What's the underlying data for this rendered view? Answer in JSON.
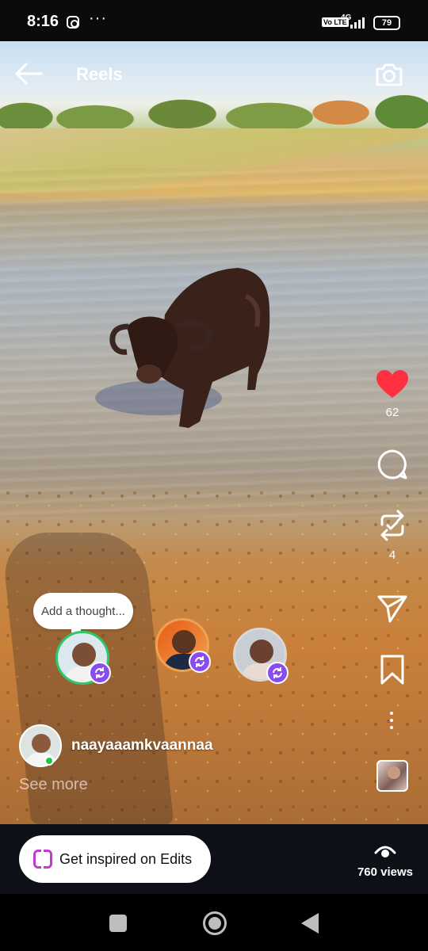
{
  "status_bar": {
    "time": "8:16",
    "dots": "···",
    "volte": "Vo LTE",
    "network": "4G",
    "battery": "79"
  },
  "header": {
    "title": "Reels",
    "back_icon": "arrow-left-icon",
    "camera_icon": "camera-icon"
  },
  "actions": {
    "like_count": "62",
    "remix_count": "4",
    "like_color": "#ff3040"
  },
  "thought_bubble": {
    "placeholder": "Add a thought..."
  },
  "owner": {
    "username": "naayaaamkvaannaa",
    "see_more": "See more"
  },
  "bottom": {
    "edits_label": "Get inspired on Edits",
    "views": "760 views"
  },
  "colors": {
    "remix_badge": "#8a4cf0",
    "edits_accent": "#c43ad0"
  }
}
